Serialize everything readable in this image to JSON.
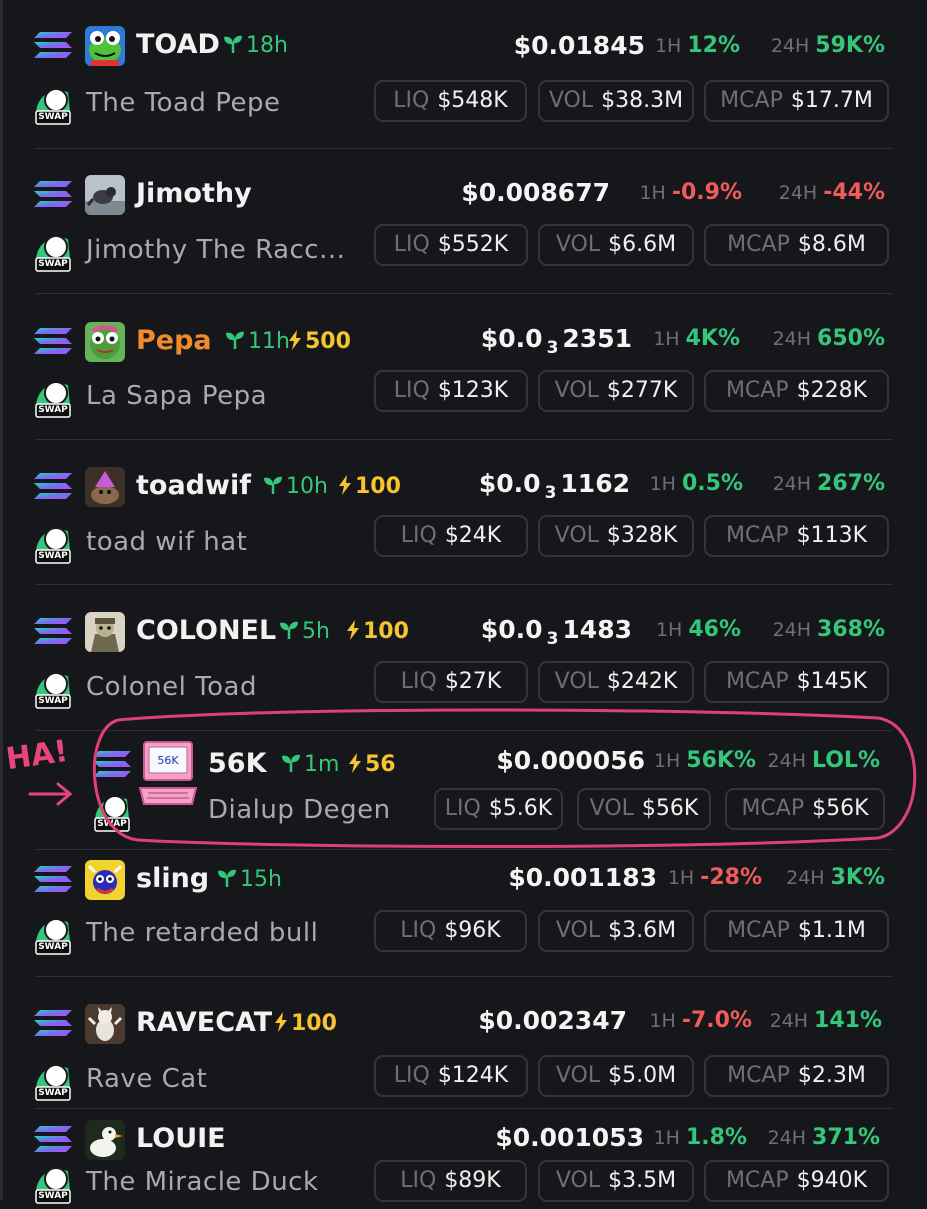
{
  "tokens": [
    {
      "symbol": "TOAD",
      "age": "18h",
      "boost": "",
      "name": "The Toad Pepe",
      "price_main": "$0.01845",
      "price_sub": "",
      "price_tail": "",
      "h1_label": "1H",
      "h1": "12%",
      "h1_dir": "up",
      "h24_label": "24H",
      "h24": "59K%",
      "h24_dir": "up",
      "liq_label": "LIQ",
      "liq": "$548K",
      "vol_label": "VOL",
      "vol": "$38.3M",
      "mcap_label": "MCAP",
      "mcap": "$17.7M",
      "symbol_color": "#f2f2f2"
    },
    {
      "symbol": "Jimothy",
      "age": "",
      "boost": "",
      "name": "Jimothy The Racc...",
      "price_main": "$0.008677",
      "price_sub": "",
      "price_tail": "",
      "h1_label": "1H",
      "h1": "-0.9%",
      "h1_dir": "down",
      "h24_label": "24H",
      "h24": "-44%",
      "h24_dir": "down",
      "liq_label": "LIQ",
      "liq": "$552K",
      "vol_label": "VOL",
      "vol": "$6.6M",
      "mcap_label": "MCAP",
      "mcap": "$8.6M",
      "symbol_color": "#f2f2f2"
    },
    {
      "symbol": "Pepa",
      "age": "11h",
      "boost": "500",
      "name": "La Sapa Pepa",
      "price_main": "$0.0",
      "price_sub": "3",
      "price_tail": "2351",
      "h1_label": "1H",
      "h1": "4K%",
      "h1_dir": "up",
      "h24_label": "24H",
      "h24": "650%",
      "h24_dir": "up",
      "liq_label": "LIQ",
      "liq": "$123K",
      "vol_label": "VOL",
      "vol": "$277K",
      "mcap_label": "MCAP",
      "mcap": "$228K",
      "symbol_color": "#f08a2c"
    },
    {
      "symbol": "toadwif",
      "age": "10h",
      "boost": "100",
      "name": "toad wif hat",
      "price_main": "$0.0",
      "price_sub": "3",
      "price_tail": "1162",
      "h1_label": "1H",
      "h1": "0.5%",
      "h1_dir": "up",
      "h24_label": "24H",
      "h24": "267%",
      "h24_dir": "up",
      "liq_label": "LIQ",
      "liq": "$24K",
      "vol_label": "VOL",
      "vol": "$328K",
      "mcap_label": "MCAP",
      "mcap": "$113K",
      "symbol_color": "#f2f2f2"
    },
    {
      "symbol": "COLONEL",
      "age": "5h",
      "boost": "100",
      "name": "Colonel Toad",
      "price_main": "$0.0",
      "price_sub": "3",
      "price_tail": "1483",
      "h1_label": "1H",
      "h1": "46%",
      "h1_dir": "up",
      "h24_label": "24H",
      "h24": "368%",
      "h24_dir": "up",
      "liq_label": "LIQ",
      "liq": "$27K",
      "vol_label": "VOL",
      "vol": "$242K",
      "mcap_label": "MCAP",
      "mcap": "$145K",
      "symbol_color": "#f2f2f2"
    },
    {
      "symbol": "56K",
      "age": "1m",
      "boost": "56",
      "name": "Dialup Degen",
      "price_main": "$0.000056",
      "price_sub": "",
      "price_tail": "",
      "h1_label": "1H",
      "h1": "56K%",
      "h1_dir": "up",
      "h24_label": "24H",
      "h24": "LOL%",
      "h24_dir": "up",
      "liq_label": "LIQ",
      "liq": "$5.6K",
      "vol_label": "VOL",
      "vol": "$56K",
      "mcap_label": "MCAP",
      "mcap": "$56K",
      "symbol_color": "#f2f2f2"
    },
    {
      "symbol": "sling",
      "age": "15h",
      "boost": "",
      "name": "The retarded bull",
      "price_main": "$0.001183",
      "price_sub": "",
      "price_tail": "",
      "h1_label": "1H",
      "h1": "-28%",
      "h1_dir": "down",
      "h24_label": "24H",
      "h24": "3K%",
      "h24_dir": "up",
      "liq_label": "LIQ",
      "liq": "$96K",
      "vol_label": "VOL",
      "vol": "$3.6M",
      "mcap_label": "MCAP",
      "mcap": "$1.1M",
      "symbol_color": "#f2f2f2"
    },
    {
      "symbol": "RAVECAT",
      "age": "",
      "boost": "100",
      "name": "Rave Cat",
      "price_main": "$0.002347",
      "price_sub": "",
      "price_tail": "",
      "h1_label": "1H",
      "h1": "-7.0%",
      "h1_dir": "down",
      "h24_label": "24H",
      "h24": "141%",
      "h24_dir": "up",
      "liq_label": "LIQ",
      "liq": "$124K",
      "vol_label": "VOL",
      "vol": "$5.0M",
      "mcap_label": "MCAP",
      "mcap": "$2.3M",
      "symbol_color": "#f2f2f2"
    },
    {
      "symbol": "LOUIE",
      "age": "",
      "boost": "",
      "name": "The Miracle Duck",
      "price_main": "$0.001053",
      "price_sub": "",
      "price_tail": "",
      "h1_label": "1H",
      "h1": "1.8%",
      "h1_dir": "up",
      "h24_label": "24H",
      "h24": "371%",
      "h24_dir": "up",
      "liq_label": "LIQ",
      "liq": "$89K",
      "vol_label": "VOL",
      "vol": "$3.5M",
      "mcap_label": "MCAP",
      "mcap": "$940K",
      "symbol_color": "#f2f2f2"
    }
  ],
  "swap_badge": "SWAP",
  "annotation": {
    "text": "HA!",
    "color": "#e8457c"
  },
  "monitor_label": "56K",
  "colors": {
    "background": "#16171b",
    "up": "#34c77b",
    "down": "#f05b5b",
    "boost": "#f5c430",
    "muted": "#6e6f75"
  }
}
